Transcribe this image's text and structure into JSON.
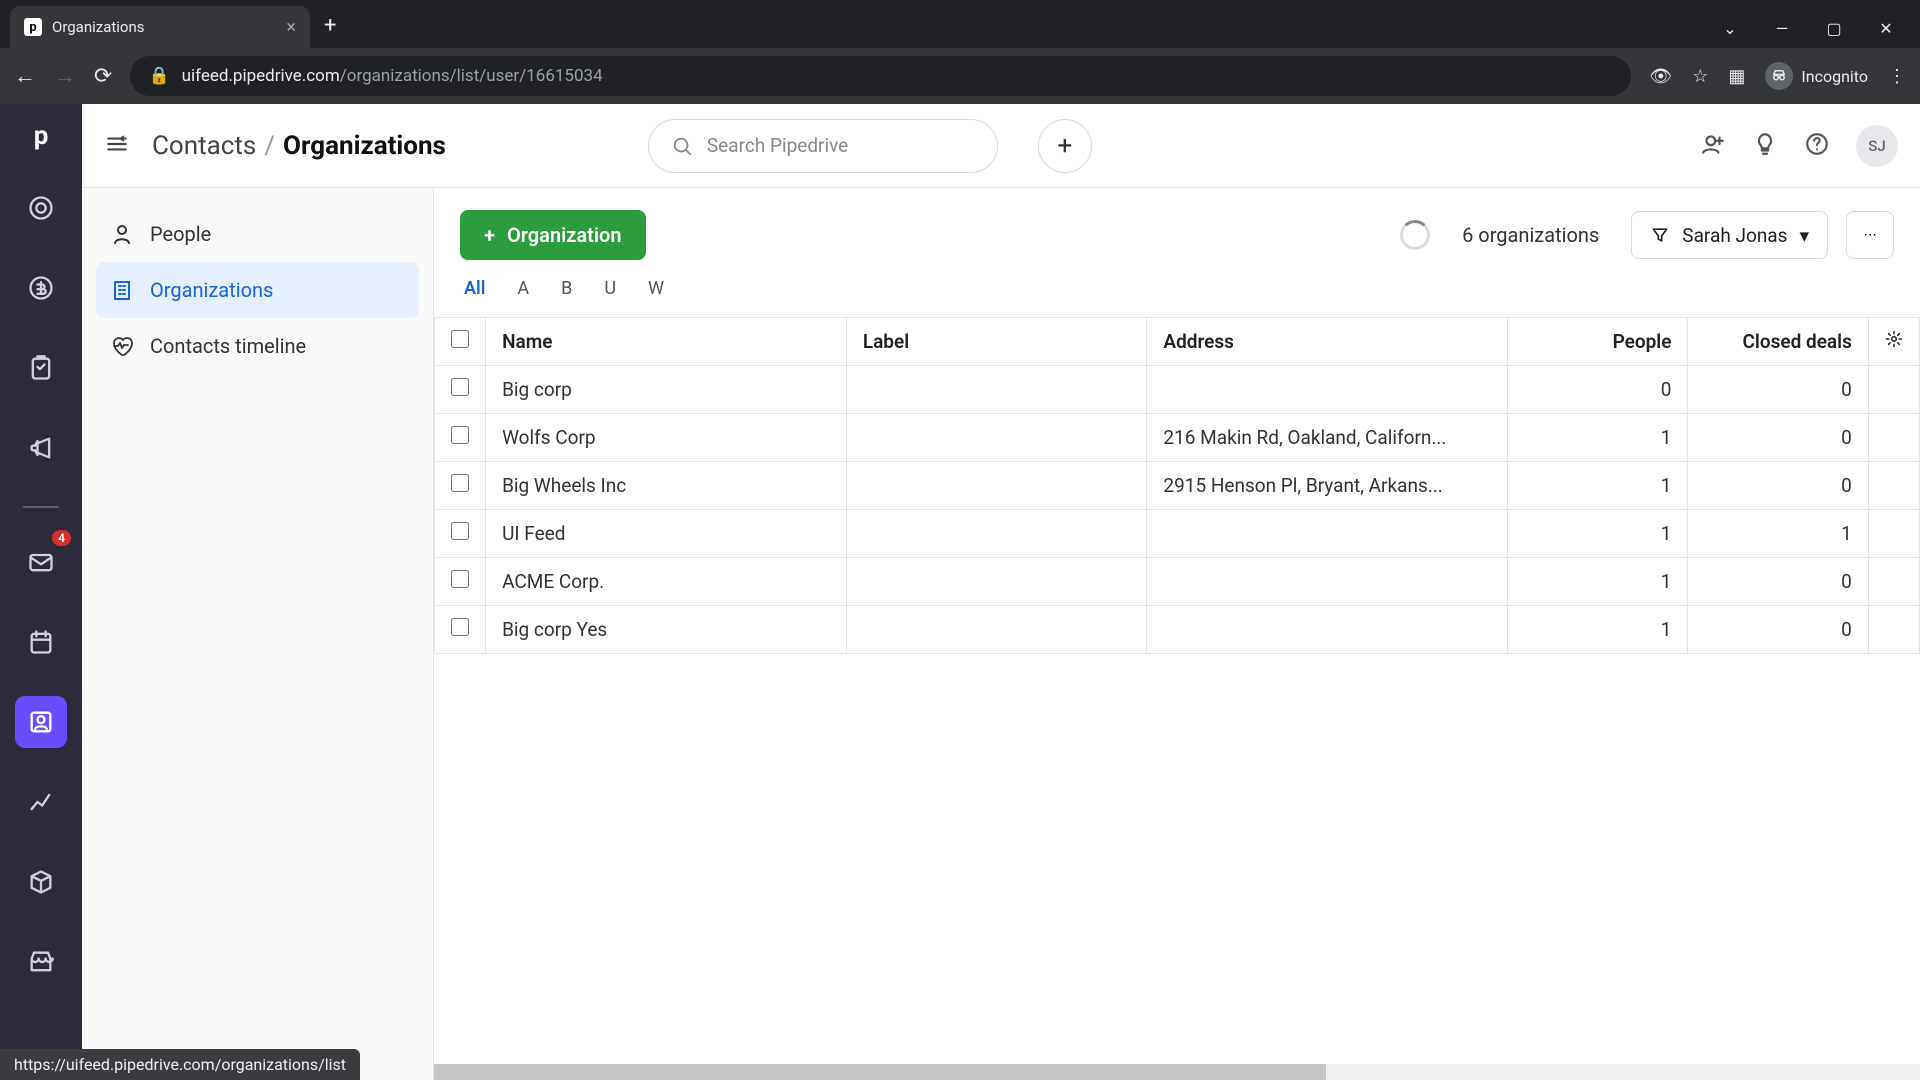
{
  "browser": {
    "tab_title": "Organizations",
    "url_display_prefix": "uifeed.pipedrive.com",
    "url_display_path": "/organizations/list/user/16615034",
    "incognito_label": "Incognito"
  },
  "rail": {
    "mail_badge": "4"
  },
  "topbar": {
    "crumb_parent": "Contacts",
    "crumb_current": "Organizations",
    "search_placeholder": "Search Pipedrive",
    "avatar_initials": "SJ"
  },
  "subnav": {
    "people": "People",
    "organizations": "Organizations",
    "timeline": "Contacts timeline"
  },
  "panel": {
    "add_button": "Organization",
    "count": "6 organizations",
    "filter_user": "Sarah Jonas",
    "alpha": [
      "All",
      "A",
      "B",
      "U",
      "W"
    ],
    "alpha_active": "All"
  },
  "table": {
    "headers": {
      "name": "Name",
      "label": "Label",
      "address": "Address",
      "people": "People",
      "closed": "Closed deals"
    },
    "rows": [
      {
        "name": "Big corp",
        "label": "",
        "address": "",
        "people": "0",
        "closed": "0"
      },
      {
        "name": "Wolfs Corp",
        "label": "",
        "address": "216 Makin Rd, Oakland, Californ...",
        "people": "1",
        "closed": "0"
      },
      {
        "name": "Big Wheels Inc",
        "label": "",
        "address": "2915 Henson Pl, Bryant, Arkans...",
        "people": "1",
        "closed": "0"
      },
      {
        "name": "UI Feed",
        "label": "",
        "address": "",
        "people": "1",
        "closed": "1"
      },
      {
        "name": "ACME Corp.",
        "label": "",
        "address": "",
        "people": "1",
        "closed": "0"
      },
      {
        "name": "Big corp Yes",
        "label": "",
        "address": "",
        "people": "1",
        "closed": "0"
      }
    ]
  },
  "status_url": "https://uifeed.pipedrive.com/organizations/list"
}
